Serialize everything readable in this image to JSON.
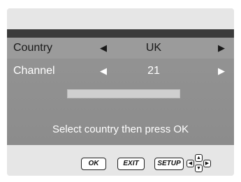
{
  "menu": {
    "rows": [
      {
        "label": "Country",
        "value": "UK",
        "left_arrow": "◀",
        "right_arrow": "▶",
        "selected": true
      },
      {
        "label": "Channel",
        "value": "21",
        "left_arrow": "◀",
        "right_arrow": "▶",
        "selected": false
      }
    ],
    "progress_fraction": 0.0,
    "prompt": "Select country then press OK"
  },
  "footer": {
    "ok_label": "OK",
    "exit_label": "EXIT",
    "setup_label": "SETUP",
    "dpad": {
      "up": "▲",
      "down": "▼",
      "left": "◀",
      "right": "▶"
    }
  },
  "colors": {
    "background": "#e6e6e6",
    "header_bar": "#3b3b3b",
    "panel": "#8f8f8f",
    "selected_row": "#9b9b9b",
    "progress_track": "#cfcfcf",
    "text_light": "#ffffff",
    "text_dark": "#1a1a1a"
  }
}
